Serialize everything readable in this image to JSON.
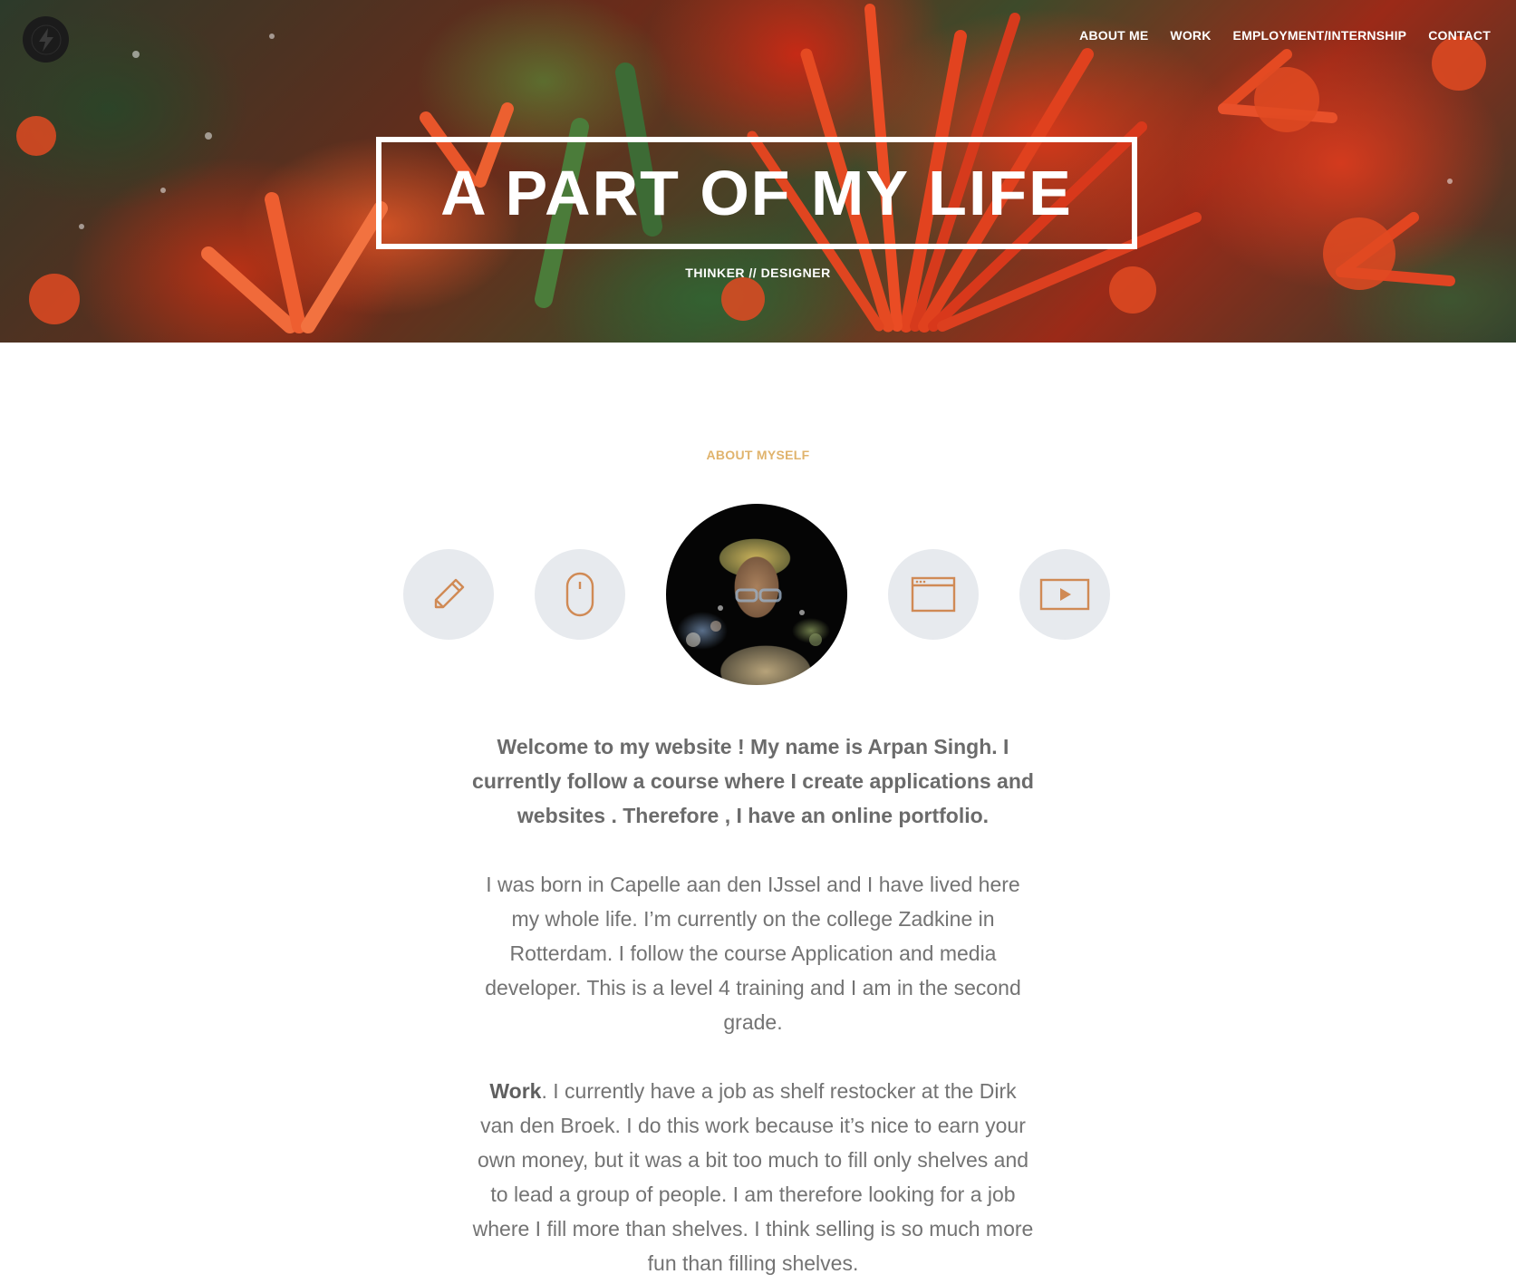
{
  "nav": {
    "items": [
      "ABOUT ME",
      "WORK",
      "EMPLOYMENT/INTERNSHIP",
      "CONTACT"
    ]
  },
  "hero": {
    "title": "A PART OF MY LIFE",
    "subtitle": "THINKER // DESIGNER"
  },
  "about": {
    "label": "ABOUT MYSELF",
    "icons": [
      "pencil-icon",
      "mouse-icon",
      "browser-window-icon",
      "video-play-icon"
    ],
    "intro": "Welcome to my website ! My name is Arpan Singh. I currently follow a course where I create applications and websites . Therefore , I have an online portfolio.",
    "paragraph_1": "I was born in Capelle aan den IJssel and I have lived here my whole life. I’m currently on the college Zadkine in Rotterdam. I follow the course Application and media developer. This is a level 4 training and I am in the second grade.",
    "work_label": "Work",
    "paragraph_2": ". I currently have a job as shelf restocker at the Dirk van den Broek. I do this work because it’s nice to earn your own money, but it was a bit too much to fill only shelves and to lead a group of people. I am therefore looking for a job where I fill more than shelves. I think selling is so much more fun than filling shelves."
  },
  "colors": {
    "accent": "#e0b36c",
    "icon_stroke": "#d08a55",
    "icon_bg": "#e7eaee",
    "text": "#6b6b6b"
  }
}
